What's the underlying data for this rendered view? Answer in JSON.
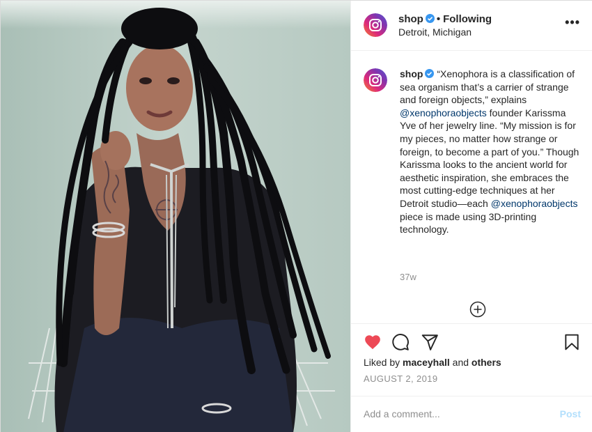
{
  "account": {
    "username": "shop",
    "follow_label": "Following",
    "separator": "•",
    "location": "Detroit, Michigan"
  },
  "caption": {
    "username": "shop",
    "parts": [
      "“Xenophora is a classification of sea organism that’s a carrier of strange and foreign objects,” explains ",
      "@xenophoraobjects",
      " founder Karissma Yve of her jewelry line. “My mission is for my pieces, no matter how strange or foreign, to become a part of you.” Though Karissma looks to the ancient world for aesthetic inspiration, she embraces the most cutting-edge techniques at her Detroit studio—each ",
      "@xenophoraobjects",
      " piece is made using 3D-printing technology."
    ],
    "time": "37w"
  },
  "engagement": {
    "liked_prefix": "Liked by",
    "liked_user": "maceyhall",
    "and": "and",
    "others": "others",
    "date": "AUGUST 2, 2019",
    "liked": true
  },
  "comment": {
    "placeholder": "Add a comment...",
    "post_label": "Post"
  },
  "icons": {
    "more": "more-options-icon",
    "like": "heart-icon",
    "comment": "comment-icon",
    "share": "share-icon",
    "save": "bookmark-icon",
    "load_more": "plus-circle-icon"
  },
  "colors": {
    "heart": "#ed4956",
    "mention": "#00376b",
    "post_disabled": "#b2dffc",
    "verified": "#3897f0",
    "secondary_text": "#8e8e8e"
  }
}
